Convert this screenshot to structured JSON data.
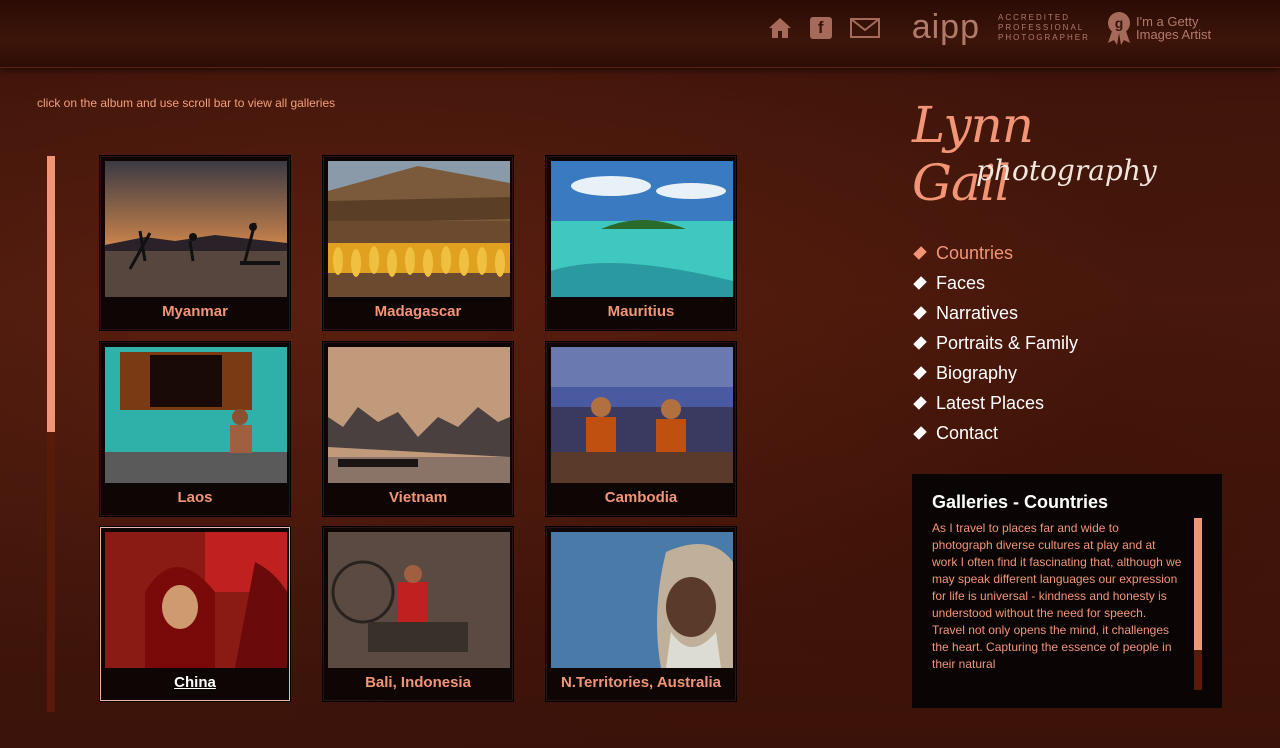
{
  "header": {
    "icons": [
      "home-icon",
      "facebook-icon",
      "mail-icon"
    ],
    "facebook_glyph": "f",
    "aipp_text": "aipp",
    "accredited_text": "ACCREDITED PROFESSIONAL PHOTOGRAPHER",
    "getty_badge_letter": "g",
    "getty_text": "I'm a Getty Images Artist"
  },
  "hint": "click on the album and use scroll bar to view all galleries",
  "galleries": [
    {
      "label": "Myanmar"
    },
    {
      "label": "Madagascar"
    },
    {
      "label": "Mauritius"
    },
    {
      "label": "Laos"
    },
    {
      "label": "Vietnam"
    },
    {
      "label": "Cambodia"
    },
    {
      "label": "China"
    },
    {
      "label": "Bali, Indonesia"
    },
    {
      "label": "N.Territories, Australia"
    }
  ],
  "logo": {
    "line1": "Lynn Gail",
    "line2": "photography"
  },
  "nav": {
    "items": [
      {
        "label": "Countries"
      },
      {
        "label": "Faces"
      },
      {
        "label": "Narratives"
      },
      {
        "label": "Portraits & Family"
      },
      {
        "label": "Biography"
      },
      {
        "label": "Latest Places"
      },
      {
        "label": "Contact"
      }
    ]
  },
  "info": {
    "title": "Galleries - Countries",
    "body": "As I travel to places far and wide to photograph diverse cultures at play and at work I often find it fascinating that, although we may speak different languages our expression for life is universal - kindness and honesty is understood without the need for speech. Travel not only opens the mind, it challenges the heart. Capturing the essence of people in their natural"
  },
  "colors": {
    "accent": "#f29577",
    "background": "#3b130a",
    "panel": "#0a0504"
  }
}
